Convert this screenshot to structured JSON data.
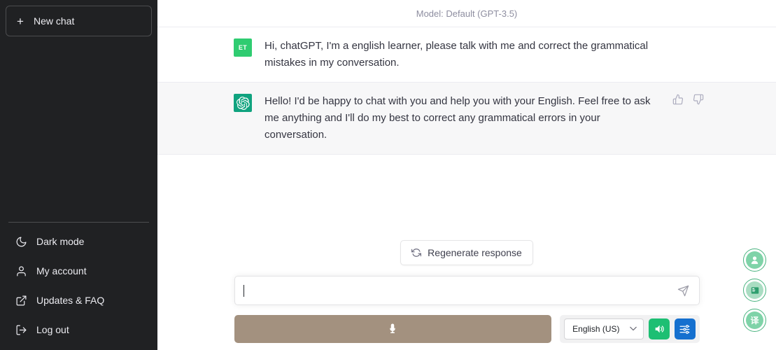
{
  "sidebar": {
    "new_chat_label": "New chat",
    "new_chat_icon": "plus-icon",
    "plus_glyph": "+",
    "items": [
      {
        "label": "Dark mode",
        "icon": "moon-icon"
      },
      {
        "label": "My account",
        "icon": "user-icon"
      },
      {
        "label": "Updates & FAQ",
        "icon": "external-link-icon"
      },
      {
        "label": "Log out",
        "icon": "logout-icon"
      }
    ]
  },
  "header": {
    "model_label": "Model: Default (GPT-3.5)"
  },
  "thread": {
    "messages": [
      {
        "role": "user",
        "avatar_text": "ET",
        "avatar_color": "#2fcc71",
        "text": "Hi, chatGPT, I'm a english learner, please talk with me and correct the grammatical mistakes in my conversation."
      },
      {
        "role": "assistant",
        "avatar_text": "",
        "avatar_color": "#10a37f",
        "text": "Hello! I'd be happy to chat with you and help you with your English. Feel free to ask me anything and I'll do my best to correct any grammatical errors in your conversation."
      }
    ],
    "feedback": {
      "thumbs_up_icon": "thumbs-up-icon",
      "thumbs_down_icon": "thumbs-down-icon"
    }
  },
  "composer": {
    "regenerate_label": "Regenerate response",
    "regenerate_icon": "refresh-icon",
    "input_value": "",
    "input_placeholder": "",
    "send_icon": "send-icon",
    "mic_icon": "microphone-icon",
    "language_value": "English (US)",
    "chevron_glyph": "∨",
    "speaker_icon": "speaker-icon",
    "settings_icon": "sliders-icon"
  },
  "floating_widgets": [
    {
      "name": "avatar-widget",
      "icon": "person-icon",
      "glyph": ""
    },
    {
      "name": "translate-widget",
      "icon": "book-icon",
      "glyph": ""
    },
    {
      "name": "translate-cn-widget",
      "icon": "translate-icon",
      "glyph": "译"
    }
  ],
  "colors": {
    "sidebar_bg": "#202123",
    "brand_green": "#10a37f",
    "assistant_row_bg": "#f7f7f8",
    "mic_button": "#a3917f",
    "speaker_green": "#1dbf73",
    "settings_blue": "#1570cf"
  }
}
